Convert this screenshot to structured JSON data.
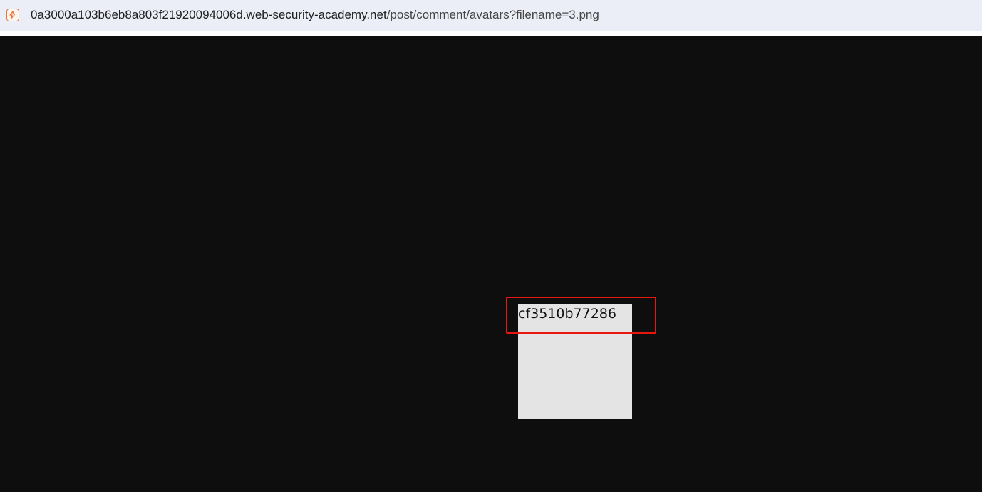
{
  "address_bar": {
    "url_host": "0a3000a103b6eb8a803f21920094006d.web-security-academy.net",
    "url_path": "/post/comment/avatars?filename=3.png",
    "site_icon": "lightning-bolt-icon"
  },
  "viewport": {
    "background_color": "#0e0e0e",
    "image": {
      "text": "cf3510b77286",
      "background_color": "#e4e4e4"
    },
    "annotation": {
      "type": "highlight-box",
      "color": "#e8160e"
    }
  }
}
